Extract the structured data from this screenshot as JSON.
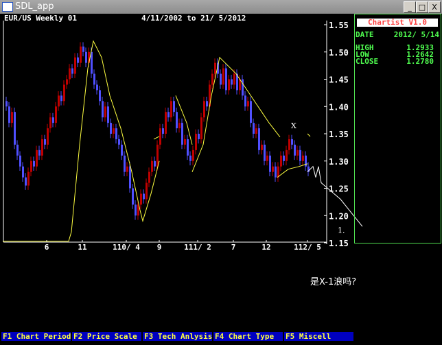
{
  "window": {
    "title": "SDL_app",
    "controls": [
      "_",
      "□",
      "X"
    ]
  },
  "header": {
    "symbol": "EUR/US Weekly 01",
    "range": "4/11/2002 to 21/ 5/2012"
  },
  "panel": {
    "brand": "Chartist V1.0",
    "date_label": "DATE",
    "date": "2012/ 5/14",
    "rows": [
      {
        "label": "HIGH",
        "value": "1.2933"
      },
      {
        "label": "LOW",
        "value": "1.2642"
      },
      {
        "label": "CLOSE",
        "value": "1.2780"
      }
    ]
  },
  "annotation": "是X-1浪吗?",
  "function_keys": [
    "F1 Chart Period",
    "F2 Price Scale",
    "F3 Tech Anlysis",
    "F4 Chart Type",
    "F5 Miscell"
  ],
  "chart_data": {
    "type": "candlestick",
    "title": "EUR/US Weekly 01",
    "ylim": [
      1.15,
      1.55
    ],
    "y_ticks": [
      "1.55",
      "1.50",
      "1.45",
      "1.40",
      "1.35",
      "1.30",
      "1.25",
      "1.20",
      "1.15"
    ],
    "x_ticks": [
      {
        "label": "6",
        "i": 15
      },
      {
        "label": "11",
        "i": 28
      },
      {
        "label": "110/ 4",
        "i": 44
      },
      {
        "label": "9",
        "i": 56
      },
      {
        "label": "111/ 2",
        "i": 70
      },
      {
        "label": "7",
        "i": 83
      },
      {
        "label": "12",
        "i": 95
      },
      {
        "label": "112/ 5",
        "i": 110
      }
    ],
    "up_color": "#c00000",
    "down_color": "#5050ff",
    "ma_color": "#ffff40",
    "closes": [
      1.4,
      1.37,
      1.39,
      1.33,
      1.31,
      1.29,
      1.27,
      1.255,
      1.28,
      1.3,
      1.29,
      1.32,
      1.31,
      1.34,
      1.33,
      1.36,
      1.38,
      1.37,
      1.4,
      1.42,
      1.41,
      1.44,
      1.45,
      1.47,
      1.46,
      1.49,
      1.48,
      1.51,
      1.5,
      1.48,
      1.5,
      1.46,
      1.44,
      1.43,
      1.41,
      1.38,
      1.4,
      1.37,
      1.35,
      1.36,
      1.34,
      1.33,
      1.31,
      1.28,
      1.29,
      1.25,
      1.22,
      1.2,
      1.22,
      1.24,
      1.23,
      1.26,
      1.28,
      1.3,
      1.29,
      1.33,
      1.36,
      1.35,
      1.39,
      1.38,
      1.41,
      1.39,
      1.36,
      1.37,
      1.33,
      1.34,
      1.31,
      1.3,
      1.32,
      1.35,
      1.34,
      1.38,
      1.41,
      1.4,
      1.44,
      1.46,
      1.48,
      1.46,
      1.44,
      1.47,
      1.43,
      1.45,
      1.44,
      1.46,
      1.43,
      1.45,
      1.42,
      1.4,
      1.41,
      1.37,
      1.35,
      1.36,
      1.32,
      1.33,
      1.3,
      1.31,
      1.28,
      1.29,
      1.27,
      1.29,
      1.31,
      1.3,
      1.32,
      1.34,
      1.33,
      1.31,
      1.32,
      1.3,
      1.31,
      1.29,
      1.28
    ],
    "ma_segments": [
      [
        [
          -1,
          1.153
        ],
        [
          23,
          1.153
        ],
        [
          24,
          1.17
        ],
        [
          27,
          1.33
        ],
        [
          30,
          1.47
        ],
        [
          32,
          1.52
        ],
        [
          35,
          1.49
        ],
        [
          38,
          1.42
        ],
        [
          42,
          1.36
        ],
        [
          46,
          1.28
        ],
        [
          49,
          1.21
        ],
        [
          50,
          1.19
        ],
        [
          53,
          1.24
        ],
        [
          56,
          1.3
        ]
      ],
      [
        [
          54,
          1.34
        ],
        [
          56,
          1.345
        ]
      ],
      [
        [
          62,
          1.42
        ],
        [
          66,
          1.37
        ],
        [
          68,
          1.33
        ]
      ],
      [
        [
          68,
          1.28
        ],
        [
          72,
          1.33
        ],
        [
          75,
          1.42
        ],
        [
          78,
          1.49
        ],
        [
          84,
          1.46
        ],
        [
          88,
          1.43
        ],
        [
          92,
          1.4
        ],
        [
          96,
          1.37
        ],
        [
          100,
          1.344
        ]
      ],
      [
        [
          99,
          1.27
        ],
        [
          103,
          1.285
        ],
        [
          107,
          1.29
        ],
        [
          110,
          1.295
        ]
      ],
      [
        [
          110,
          1.35
        ],
        [
          111,
          1.345
        ]
      ]
    ],
    "projection": [
      [
        110,
        1.28
      ],
      [
        112,
        1.29
      ],
      [
        113,
        1.27
      ],
      [
        114,
        1.29
      ],
      [
        115,
        1.26
      ],
      [
        122,
        1.23
      ],
      [
        130,
        1.18
      ]
    ],
    "labels": [
      {
        "text": "X",
        "i": 104,
        "y": 1.36
      },
      {
        "text": "1.",
        "i": 121,
        "y": 1.168
      }
    ]
  }
}
